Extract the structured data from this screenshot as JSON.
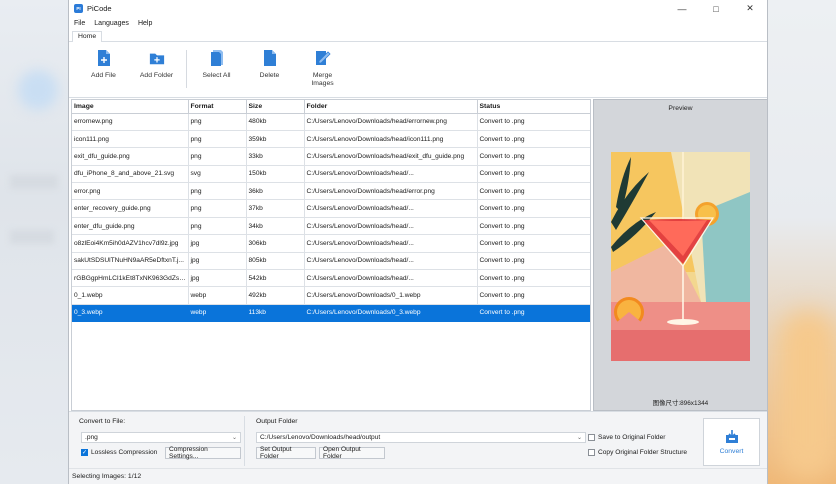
{
  "window": {
    "title": "PiCode",
    "app_icon_text": "PI"
  },
  "menu": [
    "File",
    "Languages",
    "Help"
  ],
  "ribbon_tab": "Home",
  "toolbar": [
    {
      "label": "Add File",
      "icon": "add-file-icon"
    },
    {
      "label": "Add Folder",
      "icon": "add-folder-icon"
    },
    {
      "label": "Select All",
      "icon": "select-all-icon"
    },
    {
      "label": "Delete",
      "icon": "delete-icon"
    },
    {
      "label": "Merge\nImages",
      "icon": "merge-images-icon"
    }
  ],
  "table": {
    "columns": [
      "Image",
      "Format",
      "Size",
      "Folder",
      "Status"
    ],
    "rows": [
      [
        "errornew.png",
        "png",
        "480kb",
        "C:/Users/Lenovo/Downloads/head/errornew.png",
        "Convert to .png"
      ],
      [
        "icon111.png",
        "png",
        "359kb",
        "C:/Users/Lenovo/Downloads/head/icon111.png",
        "Convert to .png"
      ],
      [
        "exit_dfu_guide.png",
        "png",
        "33kb",
        "C:/Users/Lenovo/Downloads/head/exit_dfu_guide.png",
        "Convert to .png"
      ],
      [
        "dfu_iPhone_8_and_above_21.svg",
        "svg",
        "150kb",
        "C:/Users/Lenovo/Downloads/head/...",
        "Convert to .png"
      ],
      [
        "error.png",
        "png",
        "36kb",
        "C:/Users/Lenovo/Downloads/head/error.png",
        "Convert to .png"
      ],
      [
        "enter_recovery_guide.png",
        "png",
        "37kb",
        "C:/Users/Lenovo/Downloads/head/...",
        "Convert to .png"
      ],
      [
        "enter_dfu_guide.png",
        "png",
        "34kb",
        "C:/Users/Lenovo/Downloads/head/...",
        "Convert to .png"
      ],
      [
        "o8zlEoi4Km5ih0dAZV1hcv7dl9z.jpg",
        "jpg",
        "306kb",
        "C:/Users/Lenovo/Downloads/head/...",
        "Convert to .png"
      ],
      [
        "sakUtSDSUlTNuHN9aAR5eDftxnT.j...",
        "jpg",
        "805kb",
        "C:/Users/Lenovo/Downloads/head/...",
        "Convert to .png"
      ],
      [
        "rGBGgpHmLCI1kEt8TxNK963GdZs.j...",
        "jpg",
        "542kb",
        "C:/Users/Lenovo/Downloads/head/...",
        "Convert to .png"
      ],
      [
        "0_1.webp",
        "webp",
        "492kb",
        "C:/Users/Lenovo/Downloads/0_1.webp",
        "Convert to .png"
      ],
      [
        "0_3.webp",
        "webp",
        "113kb",
        "C:/Users/Lenovo/Downloads/0_3.webp",
        "Convert to .png"
      ]
    ],
    "selected_row": 11
  },
  "preview": {
    "title": "Preview",
    "size_label": "图像尺寸:896x1344"
  },
  "convert": {
    "label": "Convert to File:",
    "format": ".png",
    "lossless_label": "Lossless Compression",
    "lossless_checked": true,
    "settings_button": "Compression Settings..."
  },
  "output": {
    "label": "Output Folder",
    "path": "C:/Users/Lenovo/Downloads/head/output",
    "set_button": "Set Output Folder",
    "open_button": "Open Output Folder",
    "save_original_label": "Save to Original Folder",
    "copy_structure_label": "Copy Original Folder Structure"
  },
  "convert_button": "Convert",
  "status": "Selecting Images: 1/12",
  "colors": {
    "accent": "#0a74da",
    "selection": "#0a74da"
  }
}
